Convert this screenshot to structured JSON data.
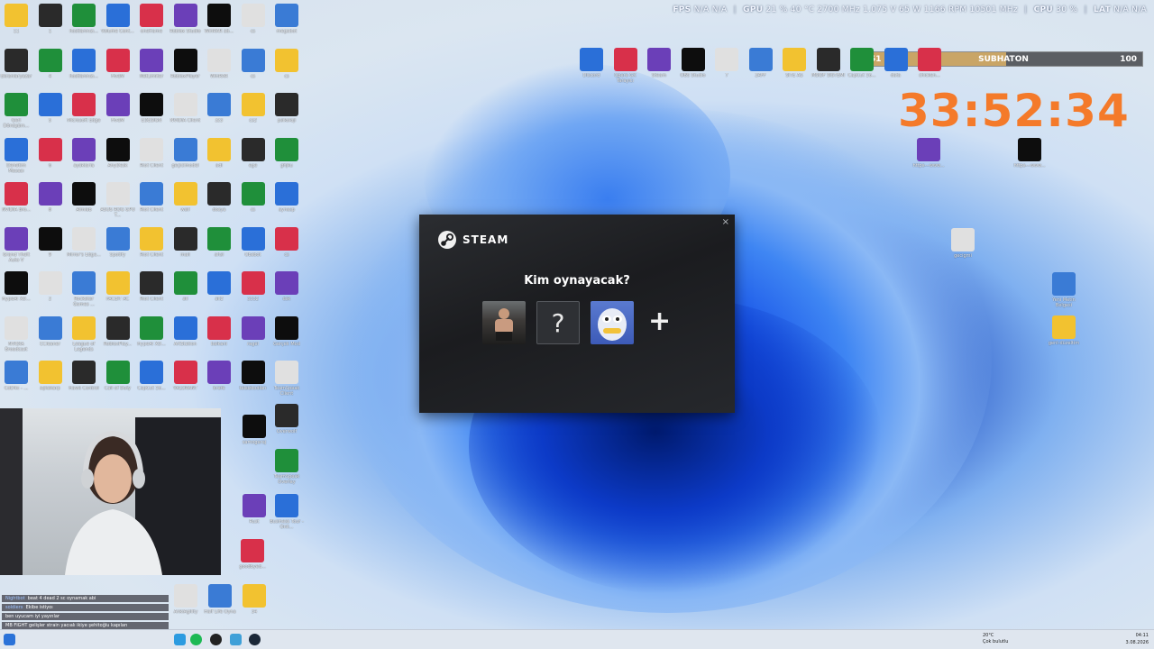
{
  "hud": {
    "fps_label": "FPS",
    "fps_values": "N/A  N/A",
    "gpu_label": "GPU",
    "gpu_values": "21 %  40 °C  2700 MHz  1.075 V  65 W  1166 RPM  10501 MHz",
    "cpu_label": "CPU",
    "cpu_value": "30 %",
    "lat_label": "LAT",
    "lat_values": "N/A  N/A"
  },
  "sub_goal": {
    "current": "51",
    "name": "SUBHATON",
    "target": "100",
    "progress": 0.51
  },
  "timer": "33:52:34",
  "steam_dialog": {
    "brand": "STEAM",
    "question": "Kim oynayacak?",
    "profiles": [
      {
        "name": "profile-fighter",
        "color": "#3b3b3b"
      },
      {
        "name": "profile-unknown",
        "glyph": "?"
      },
      {
        "name": "profile-yeti",
        "color": "#5a7ad0"
      }
    ],
    "add_glyph": "+",
    "close_glyph": "×"
  },
  "desktop_icons": {
    "col0": [
      "11",
      "Ekranlaryazar",
      "Geri Dönüşüm...",
      "Denetim Masası",
      "NVIDIA Bro...",
      "Grand Theft Auto V",
      "HypeAI XD...",
      "NVIDIA Broadcast",
      "CoD4x - ..."
    ],
    "col1": [
      "1",
      "4",
      "5",
      "6",
      "8",
      "9",
      "2",
      "CCleaner",
      "aşkakarp"
    ],
    "col2": [
      "hostlarınızı...",
      "hostlarınızı...",
      "Microsoft Edge",
      "ayaklaria",
      "Aimlab",
      "Mirror's Edge...",
      "Rockstar Games ...",
      "League of Legends",
      "Hawk Control"
    ],
    "col3": [
      "Volume Cont...",
      "FiveM",
      "FiveM",
      "AnyDesk",
      "ASUS ROG GPU T...",
      "Spotify",
      "FACEIT AC",
      "RobloxPlay...",
      "Call of Duty"
    ],
    "col4": [
      "oneframe",
      "NetLimiter",
      "EDESIGN",
      "Riot Client",
      "Riot Client",
      "Riot Client",
      "Riot Client",
      "HypeAI XD...",
      "CapCut 16..."
    ],
    "col5": [
      "Roblox Studio",
      "RobloxPlayer",
      "NVIDIA Client",
      "geçicimodel",
      "wall",
      "mail",
      "all",
      "ArtStation",
      "VALORANT"
    ],
    "col6": [
      "WinRAR ab...",
      "WinRAR",
      "zz3",
      "adi",
      "dosya",
      "ahsl",
      "all2",
      "balkani",
      "brafe"
    ],
    "col7": [
      "cs",
      "cs",
      "cs2",
      "ege",
      "cs",
      "Obsbot",
      "3332",
      "ragel",
      "telsizkodları"
    ],
    "col8": [
      "megabot",
      "cs",
      "psikoloji",
      "ghjku",
      "aynasp",
      "cs",
      "dsk",
      "Gerçek Mod",
      "TeamSpeak Client"
    ],
    "top_right": [
      "Discord",
      "Opera GX Tarayıcı",
      "Steam",
      "OBS Studio",
      "7",
      "2AFF",
      "SİTE AS",
      "MSIDF SİSTEMİ",
      "CapCut 16...",
      "data",
      "chicken..."
    ],
    "right_misc": [
      "https---www...",
      "https---www...",
      "gecigmi",
      "Yeni Metin Belgesi",
      "genl-düzeltim"
    ],
    "lower": [
      "Overwolf",
      "TeamSpeak Overlay",
      "Business Tour - Onli...",
      "goodbyed...",
      "Rust",
      "samogaraj",
      "AnkiAgility",
      "Half Life Oyna",
      "34"
    ]
  },
  "chat": [
    {
      "user": "Nightbot",
      "text": "beat 4 dead 2 sc oynamak abi"
    },
    {
      "user": "soldierx",
      "text": "Ekibe istiyoı"
    },
    {
      "user": "",
      "text": "ben uyucam iyi yayınlar"
    },
    {
      "user": "",
      "text": "MB FIGHT gelişler strain yacıalı ikiye şehitoğlu kapıları"
    }
  ],
  "taskbar": {
    "weather_temp": "20°C",
    "weather_desc": "Çok bulutlu",
    "time": "04:11",
    "date": "3.08.2026"
  }
}
